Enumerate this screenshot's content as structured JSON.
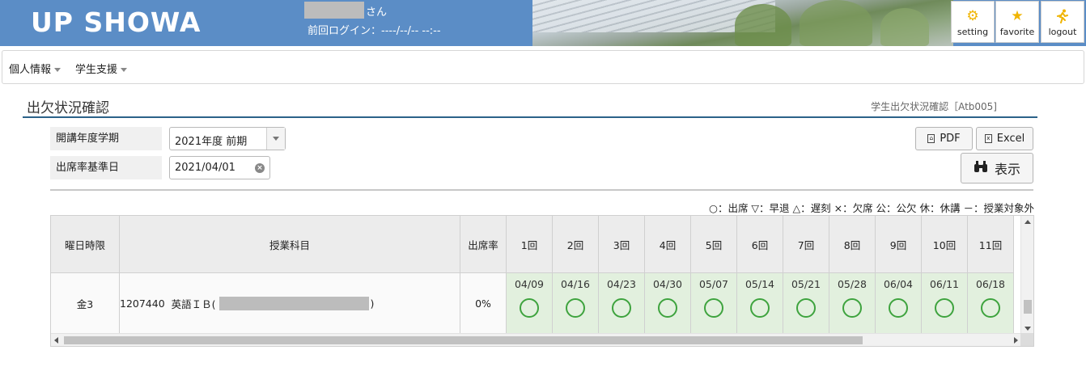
{
  "header": {
    "logo": "UP SHOWA",
    "user_suffix": "さん",
    "last_login": "前回ログイン：----/--/-- --:--",
    "buttons": {
      "setting": "setting",
      "favorite": "favorite",
      "logout": "logout"
    },
    "accent_color": "#5b8dc6"
  },
  "nav": {
    "items": [
      {
        "label": "個人情報"
      },
      {
        "label": "学生支援"
      }
    ]
  },
  "page": {
    "title": "出欠状況確認",
    "screen_id": "学生出欠状況確認［Atb005]"
  },
  "form": {
    "term_label": "開講年度学期",
    "term_value": "2021年度 前期",
    "base_date_label": "出席率基準日",
    "base_date_value": "2021/04/01",
    "pdf_label": "PDF",
    "excel_label": "Excel",
    "display_label": "表示"
  },
  "legend": "○：出席 ▽：早退 △：遅刻 ×：欠席 公：公欠 休：休講 －：授業対象外",
  "table": {
    "headers": {
      "day_period": "曜日時限",
      "subject": "授業科目",
      "rate": "出席率"
    },
    "sessions": [
      {
        "label": "1回",
        "date": "04/09",
        "mark": "circle"
      },
      {
        "label": "2回",
        "date": "04/16",
        "mark": "circle"
      },
      {
        "label": "3回",
        "date": "04/23",
        "mark": "circle"
      },
      {
        "label": "4回",
        "date": "04/30",
        "mark": "circle"
      },
      {
        "label": "5回",
        "date": "05/07",
        "mark": "circle"
      },
      {
        "label": "6回",
        "date": "05/14",
        "mark": "circle"
      },
      {
        "label": "7回",
        "date": "05/21",
        "mark": "circle"
      },
      {
        "label": "8回",
        "date": "05/28",
        "mark": "circle"
      },
      {
        "label": "9回",
        "date": "06/04",
        "mark": "circle"
      },
      {
        "label": "10回",
        "date": "06/11",
        "mark": "circle"
      },
      {
        "label": "11回",
        "date": "06/18",
        "mark": "circle"
      }
    ],
    "row": {
      "day_period": "金3",
      "subject_code": "1207440",
      "subject_name": "英語ＩＢ(",
      "subject_close": ")",
      "rate": "0%"
    },
    "attended_color": "#3ea33e"
  }
}
